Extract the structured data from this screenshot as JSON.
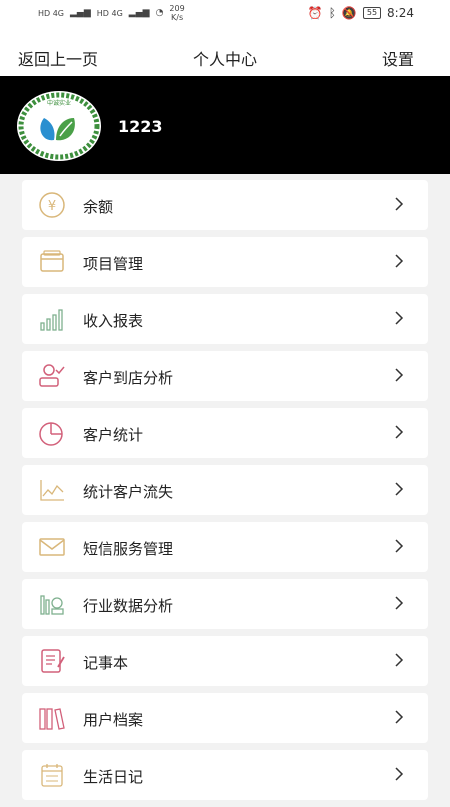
{
  "status_bar": {
    "net1": "HD 4G",
    "net2": "HD 4G",
    "speed_value": "209",
    "speed_unit": "K/s",
    "battery": "55",
    "time": "8:24"
  },
  "header": {
    "back_label": "返回上一页",
    "title": "个人中心",
    "settings_label": "设置"
  },
  "profile": {
    "username": "1223",
    "avatar_text": "中诚实业"
  },
  "menu": {
    "items": [
      {
        "label": "余额",
        "icon": "yen-coin-icon"
      },
      {
        "label": "项目管理",
        "icon": "wallet-icon"
      },
      {
        "label": "收入报表",
        "icon": "bar-chart-icon"
      },
      {
        "label": "客户到店分析",
        "icon": "customer-check-icon"
      },
      {
        "label": "客户统计",
        "icon": "pie-chart-icon"
      },
      {
        "label": "统计客户流失",
        "icon": "line-chart-icon"
      },
      {
        "label": "短信服务管理",
        "icon": "envelope-icon"
      },
      {
        "label": "行业数据分析",
        "icon": "data-analysis-icon"
      },
      {
        "label": "记事本",
        "icon": "notebook-icon"
      },
      {
        "label": "用户档案",
        "icon": "file-archive-icon"
      },
      {
        "label": "生活日记",
        "icon": "calendar-icon"
      }
    ]
  },
  "colors": {
    "profile_bg": "#000000",
    "page_bg": "#f2f2f2",
    "icon_gold": "#d9b77a",
    "icon_pink": "#d2607a",
    "icon_green": "#7fb08f"
  }
}
